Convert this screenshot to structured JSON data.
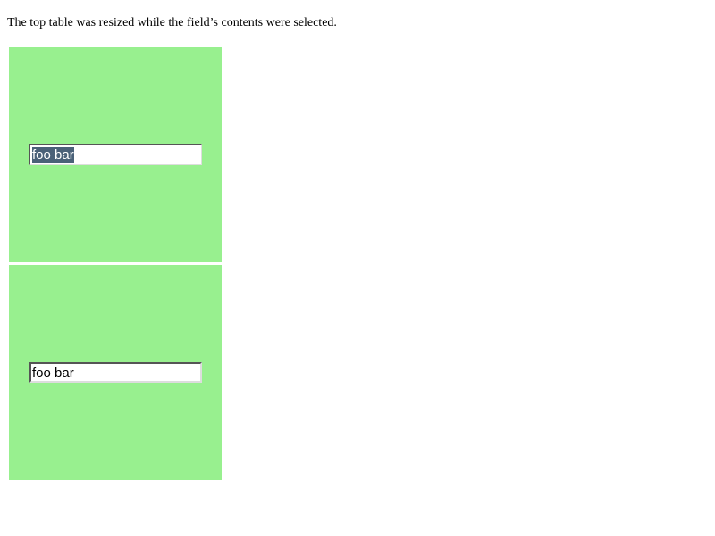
{
  "caption": "The top table was resized while the field’s contents were selected.",
  "colors": {
    "box_background": "#98f08f",
    "selection_background": "#4a6178",
    "selection_text": "#ffffff"
  },
  "top_table": {
    "field": {
      "value": "foo bar",
      "selected": true
    }
  },
  "bottom_table": {
    "field": {
      "value": "foo bar",
      "selected": false
    }
  }
}
